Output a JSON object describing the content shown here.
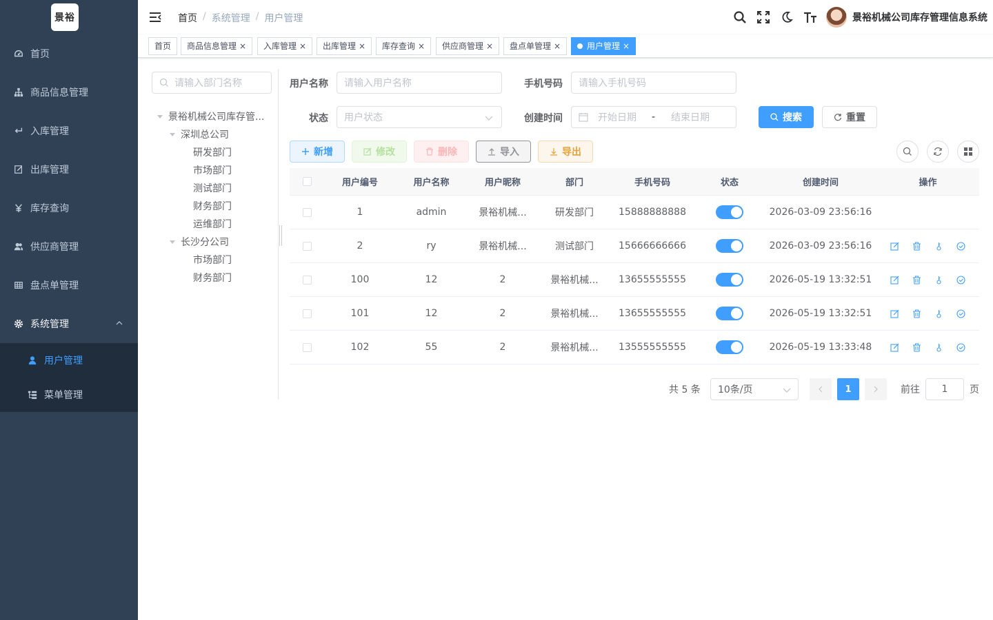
{
  "logo": {
    "text": "景裕"
  },
  "sidebar": {
    "items": [
      {
        "label": "首页",
        "icon": "dashboard-icon"
      },
      {
        "label": "商品信息管理",
        "icon": "tree-icon"
      },
      {
        "label": "入库管理",
        "icon": "enter-icon"
      },
      {
        "label": "出库管理",
        "icon": "edit-icon"
      },
      {
        "label": "库存查询",
        "icon": "money-icon"
      },
      {
        "label": "供应商管理",
        "icon": "peoples-icon"
      },
      {
        "label": "盘点单管理",
        "icon": "table-icon"
      },
      {
        "label": "系统管理",
        "icon": "gear-icon"
      }
    ],
    "sub": [
      {
        "label": "用户管理",
        "icon": "user-icon"
      },
      {
        "label": "菜单管理",
        "icon": "tree-table-icon"
      }
    ]
  },
  "navbar": {
    "breadcrumb": [
      "首页",
      "系统管理",
      "用户管理"
    ],
    "system_name": "景裕机械公司库存管理信息系统"
  },
  "tags": [
    "首页",
    "商品信息管理",
    "入库管理",
    "出库管理",
    "库存查询",
    "供应商管理",
    "盘点单管理",
    "用户管理"
  ],
  "tree": {
    "placeholder": "请输入部门名称",
    "nodes": [
      {
        "label": "景裕机械公司库存管..."
      },
      {
        "label": "深圳总公司"
      },
      {
        "label": "研发部门"
      },
      {
        "label": "市场部门"
      },
      {
        "label": "测试部门"
      },
      {
        "label": "财务部门"
      },
      {
        "label": "运维部门"
      },
      {
        "label": "长沙分公司"
      },
      {
        "label": "市场部门"
      },
      {
        "label": "财务部门"
      }
    ]
  },
  "search": {
    "username_label": "用户名称",
    "username_placeholder": "请输入用户名称",
    "phone_label": "手机号码",
    "phone_placeholder": "请输入手机号码",
    "status_label": "状态",
    "status_placeholder": "用户状态",
    "time_label": "创建时间",
    "start_placeholder": "开始日期",
    "range_sep": "-",
    "end_placeholder": "结束日期",
    "search_btn": "搜索",
    "reset_btn": "重置"
  },
  "toolbar": {
    "add": "新增",
    "edit": "修改",
    "delete": "删除",
    "import": "导入",
    "export": "导出"
  },
  "table": {
    "headers": [
      "用户编号",
      "用户名称",
      "用户昵称",
      "部门",
      "手机号码",
      "状态",
      "创建时间",
      "操作"
    ],
    "rows": [
      {
        "id": "1",
        "name": "admin",
        "nick": "景裕机械...",
        "dept": "研发部门",
        "phone": "15888888888",
        "time": "2026-03-09 23:56:16",
        "ops": false
      },
      {
        "id": "2",
        "name": "ry",
        "nick": "景裕机械...",
        "dept": "测试部门",
        "phone": "15666666666",
        "time": "2026-03-09 23:56:16",
        "ops": true
      },
      {
        "id": "100",
        "name": "12",
        "nick": "2",
        "dept": "景裕机械...",
        "phone": "13655555555",
        "time": "2026-05-19 13:32:51",
        "ops": true
      },
      {
        "id": "101",
        "name": "12",
        "nick": "2",
        "dept": "景裕机械...",
        "phone": "13655555555",
        "time": "2026-05-19 13:32:51",
        "ops": true
      },
      {
        "id": "102",
        "name": "55",
        "nick": "2",
        "dept": "景裕机械...",
        "phone": "13555555555",
        "time": "2026-05-19 13:33:48",
        "ops": true
      }
    ]
  },
  "pagination": {
    "total": "共 5 条",
    "size": "10条/页",
    "current": "1",
    "goto_label": "前往",
    "goto_value": "1",
    "page_unit": "页"
  }
}
